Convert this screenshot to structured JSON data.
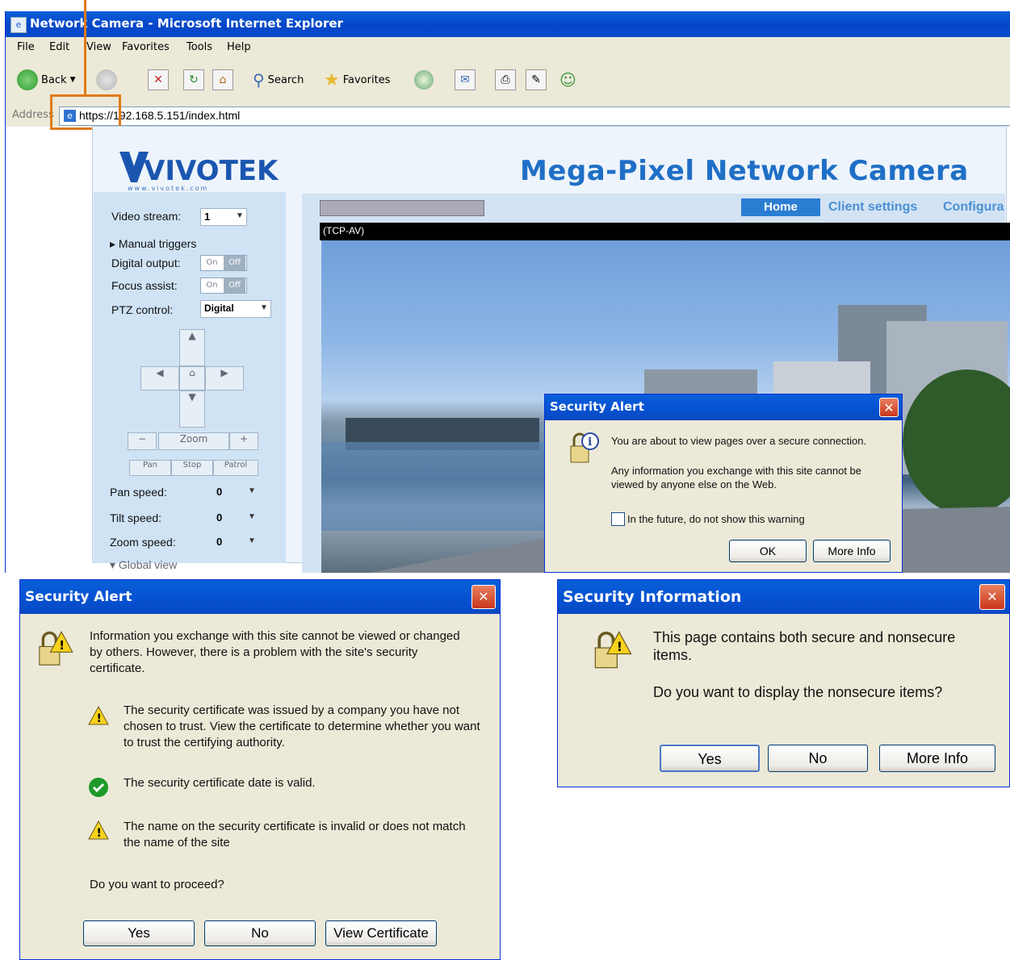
{
  "browser": {
    "title": "Network Camera - Microsoft Internet Explorer",
    "menu": [
      "File",
      "Edit",
      "View",
      "Favorites",
      "Tools",
      "Help"
    ],
    "toolbar": {
      "back": "Back",
      "search": "Search",
      "favorites": "Favorites"
    },
    "address_label": "Address",
    "url": "https://192.168.5.151/index.html"
  },
  "camera_page": {
    "brand": "VIVOTEK",
    "brand_sub": "www.vivotek.com",
    "title": "Mega-Pixel Network Camera",
    "nav": [
      "Home",
      "Client settings",
      "Configura"
    ],
    "stream_label": "(TCP-AV)",
    "left_panel": {
      "video_stream_label": "Video stream:",
      "video_stream_value": "1",
      "manual_triggers": "Manual triggers",
      "digital_output": "Digital output:",
      "focus_assist": "Focus assist:",
      "on": "On",
      "off": "Off",
      "ptz_control": "PTZ control:",
      "ptz_value": "Digital",
      "zoom": "Zoom",
      "pan": "Pan",
      "stop": "Stop",
      "patrol": "Patrol",
      "pan_speed": "Pan speed:",
      "tilt_speed": "Tilt speed:",
      "zoom_speed": "Zoom speed:",
      "speed_value": "0",
      "global_view": "Global view"
    }
  },
  "alert_small": {
    "title": "Security Alert",
    "line1": "You are about to view pages over a secure connection.",
    "line2": "Any information you exchange with this site cannot be viewed by anyone else on the Web.",
    "checkbox": "In the future, do not show this warning",
    "ok": "OK",
    "more_info": "More Info"
  },
  "alert_cert": {
    "title": "Security Alert",
    "intro": "Information you exchange with this site cannot be viewed or changed by others. However, there is a problem with the site's security certificate.",
    "item1": "The security certificate was issued by a company you have not chosen to trust. View the certificate to determine whether you want to trust the certifying authority.",
    "item2": "The security certificate date is valid.",
    "item3": "The name on the security certificate is invalid or does not match the name of the site",
    "question": "Do you want to proceed?",
    "yes": "Yes",
    "no": "No",
    "view_cert": "View Certificate"
  },
  "security_info": {
    "title": "Security Information",
    "line1": "This page contains both secure and nonsecure items.",
    "question": "Do you want to display the nonsecure items?",
    "yes": "Yes",
    "no": "No",
    "more_info": "More Info"
  },
  "colors": {
    "accent": "#e07a14",
    "titlebar": "#0546c9",
    "brand": "#1f6fc6"
  }
}
